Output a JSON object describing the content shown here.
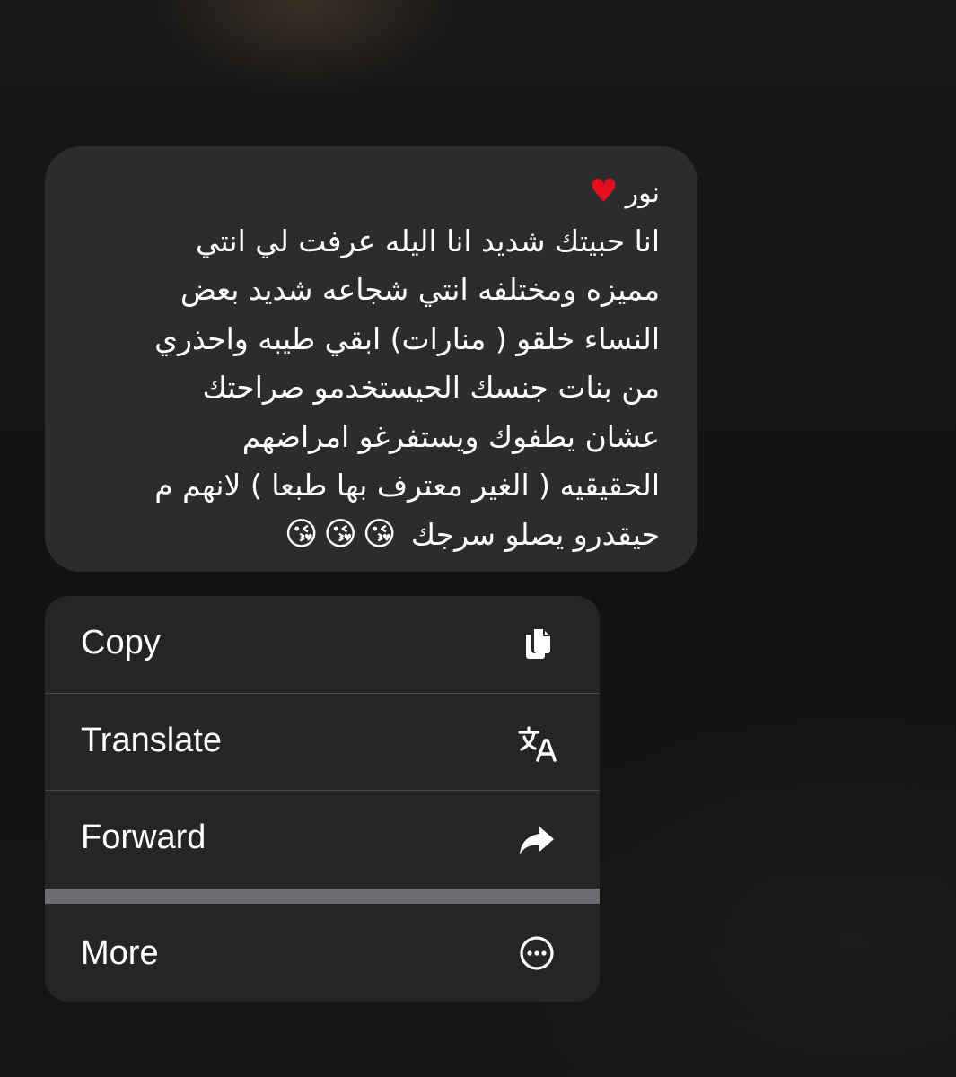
{
  "message": {
    "sender": "نور",
    "sender_icon": "red-heart-icon",
    "lines": [
      "انا حبيتك شديد انا اليله عرفت لي انتي",
      "مميزه ومختلفه انتي شجاعه شديد بعض",
      "النساء خلقو ( منارات) ابقي طيبه واحذري",
      "من بنات جنسك الحيستخدمو صراحتك",
      "عشان يطفوك ويستفرغو امراضهم",
      "الحقيقيه ( الغير معترف بها طبعا ) لانهم م"
    ],
    "last_line": "حيقدرو يصلو سرجك",
    "trailing_emoji": "kissing-face-with-heart-icon",
    "emoji_count": 3
  },
  "menu": {
    "items": [
      {
        "label": "Copy",
        "icon": "copy-icon"
      },
      {
        "label": "Translate",
        "icon": "translate-icon"
      },
      {
        "label": "Forward",
        "icon": "forward-arrow-icon"
      },
      {
        "label": "More",
        "icon": "more-ellipsis-icon"
      }
    ]
  },
  "colors": {
    "background": "#141414",
    "bubble": "#2c2c2e",
    "menu": "#252527",
    "separator": "#6a6c70",
    "heart": "#e0101e",
    "text": "#ffffff"
  }
}
